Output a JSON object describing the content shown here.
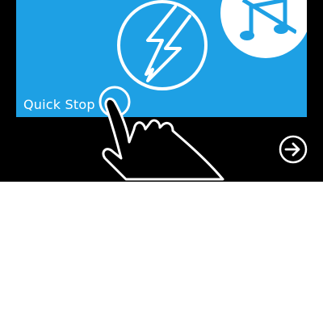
{
  "tile": {
    "label": "Quick Stop",
    "icon": "lightning-icon",
    "secondary_icon": "music-off-icon"
  },
  "gesture": {
    "icon": "tap-hand-icon"
  },
  "navigation": {
    "next_icon": "arrow-right-circle-icon"
  },
  "colors": {
    "accent": "#1ea0e4",
    "background": "#000000",
    "foreground": "#ffffff"
  }
}
